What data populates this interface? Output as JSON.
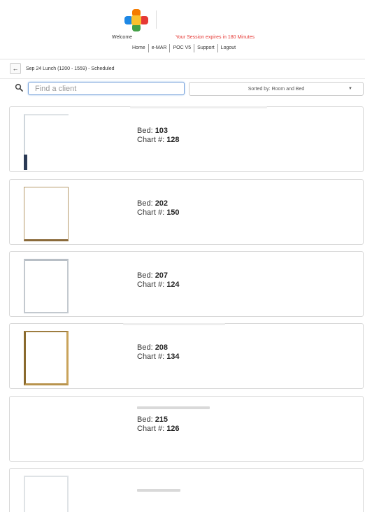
{
  "header": {
    "welcome": "Welcome",
    "session": "Your Session expires in 180 Minutes",
    "nav": [
      "Home",
      "e-MAR",
      "POC V5",
      "Support",
      "Logout"
    ]
  },
  "meal": {
    "label": "Sep 24 Lunch (1200 - 1559) - Scheduled"
  },
  "search": {
    "placeholder": "Find a client",
    "sort_label": "Sorted by: Room and Bed"
  },
  "clients": [
    {
      "bed_label": "Bed: ",
      "bed": "103",
      "chart_label": "Chart #: ",
      "chart": "128"
    },
    {
      "bed_label": "Bed: ",
      "bed": "202",
      "chart_label": "Chart #: ",
      "chart": "150"
    },
    {
      "bed_label": "Bed: ",
      "bed": "207",
      "chart_label": "Chart #: ",
      "chart": "124"
    },
    {
      "bed_label": "Bed: ",
      "bed": "208",
      "chart_label": "Chart #: ",
      "chart": "134"
    },
    {
      "bed_label": "Bed: ",
      "bed": "215",
      "chart_label": "Chart #: ",
      "chart": "126"
    }
  ],
  "icons": {
    "back": "arrow-left-icon",
    "search": "search-icon",
    "caret": "caret-down-icon"
  },
  "colors": {
    "session_warning": "#e53935",
    "focus_border": "#7ca6dd"
  }
}
